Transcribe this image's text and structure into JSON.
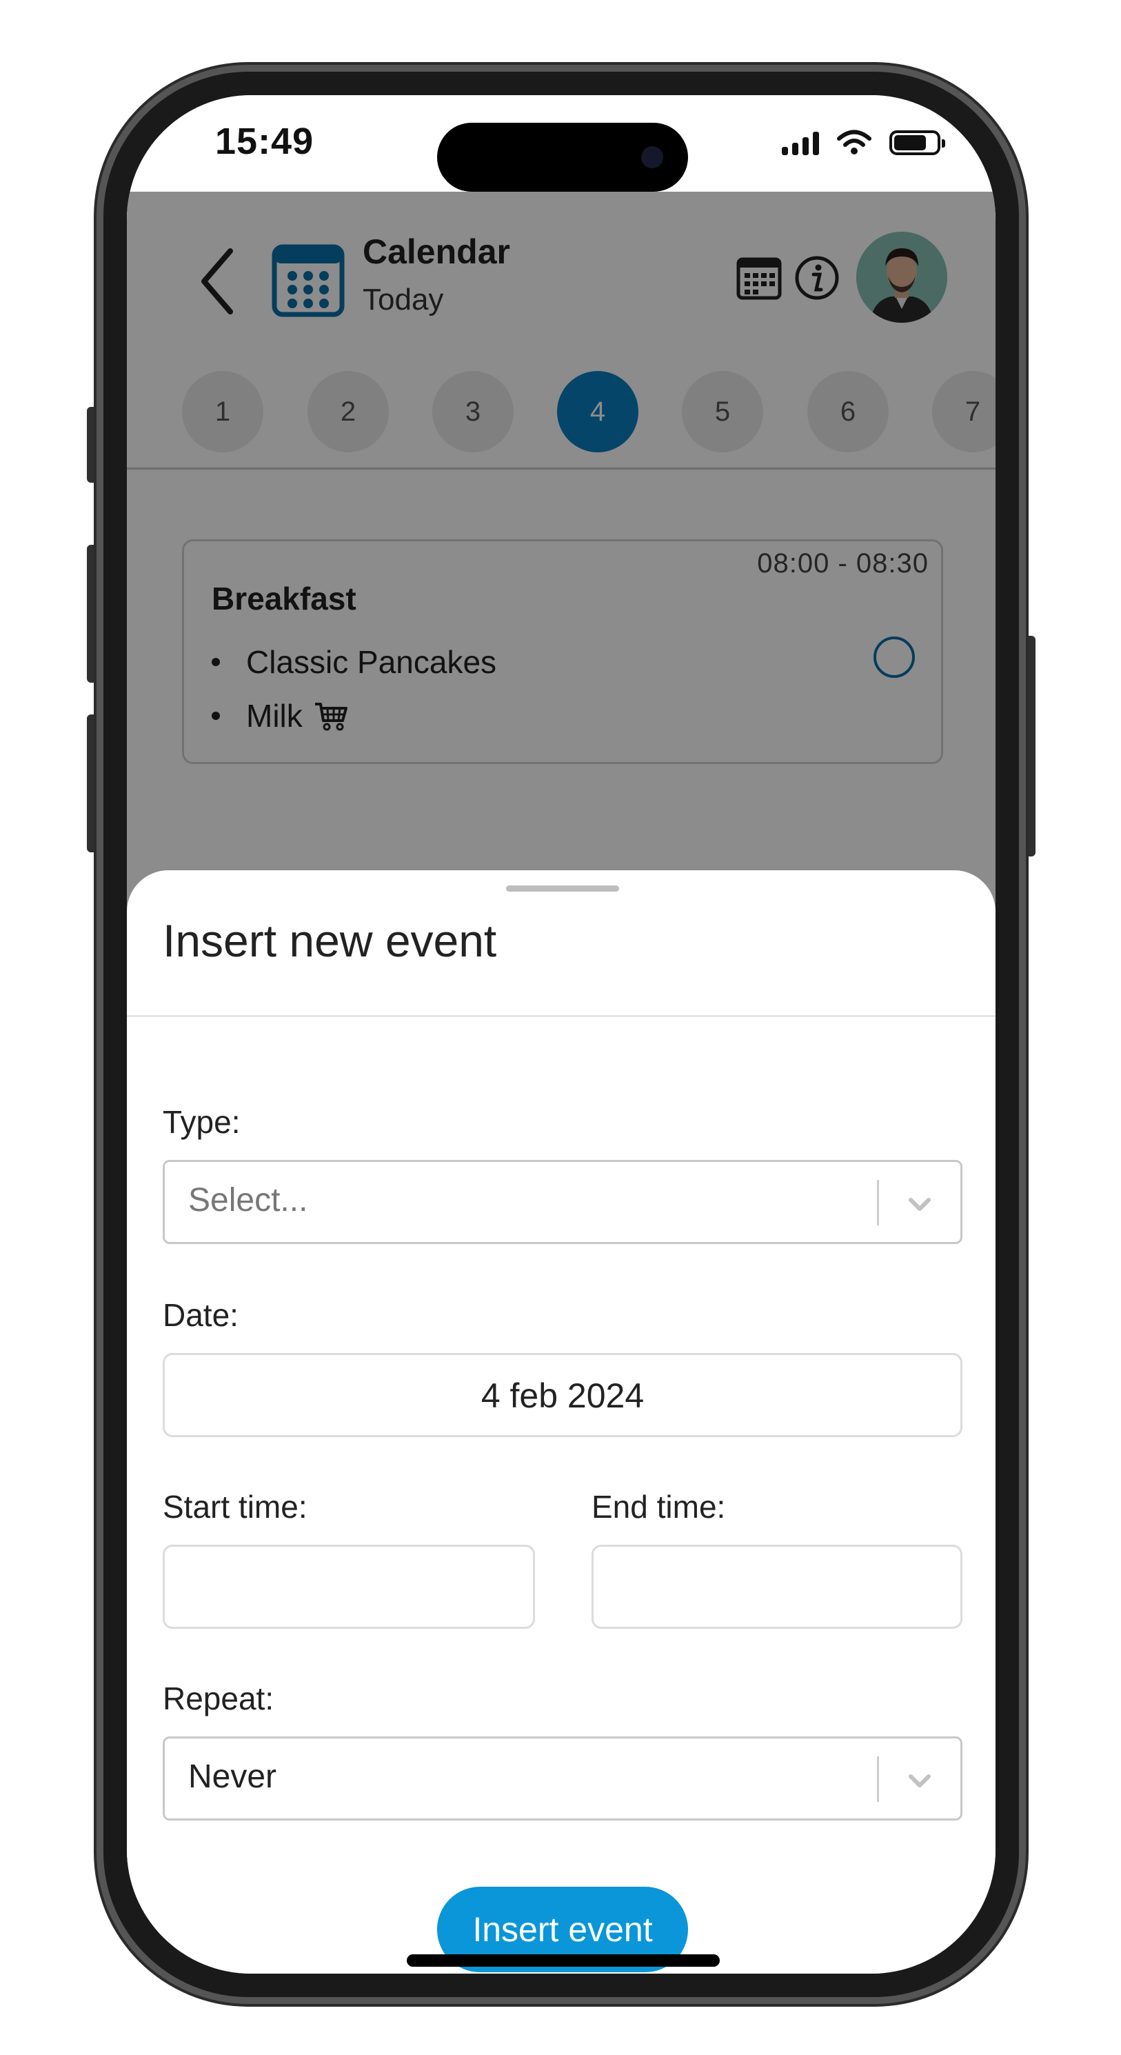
{
  "status_bar": {
    "time": "15:49"
  },
  "header": {
    "title": "Calendar",
    "subtitle": "Today",
    "icons": [
      "back-chevron-icon",
      "calendar-logo-icon",
      "calendar-grid-icon",
      "info-icon",
      "avatar"
    ]
  },
  "days": [
    "1",
    "2",
    "3",
    "4",
    "5",
    "6",
    "7"
  ],
  "active_day": "4",
  "event": {
    "time": "08:00 - 08:30",
    "title": "Breakfast",
    "items": [
      "Classic Pancakes",
      "Milk"
    ]
  },
  "sheet": {
    "title": "Insert new event",
    "type_label": "Type:",
    "type_placeholder": "Select...",
    "date_label": "Date:",
    "date_value": "4 feb 2024",
    "start_label": "Start time:",
    "end_label": "End time:",
    "start_value": "",
    "end_value": "",
    "repeat_label": "Repeat:",
    "repeat_value": "Never",
    "submit_label": "Insert event"
  },
  "colors": {
    "accent": "#0a7fbf",
    "button": "#0a96d8",
    "overlay": "rgba(0,0,0,0.45)"
  }
}
